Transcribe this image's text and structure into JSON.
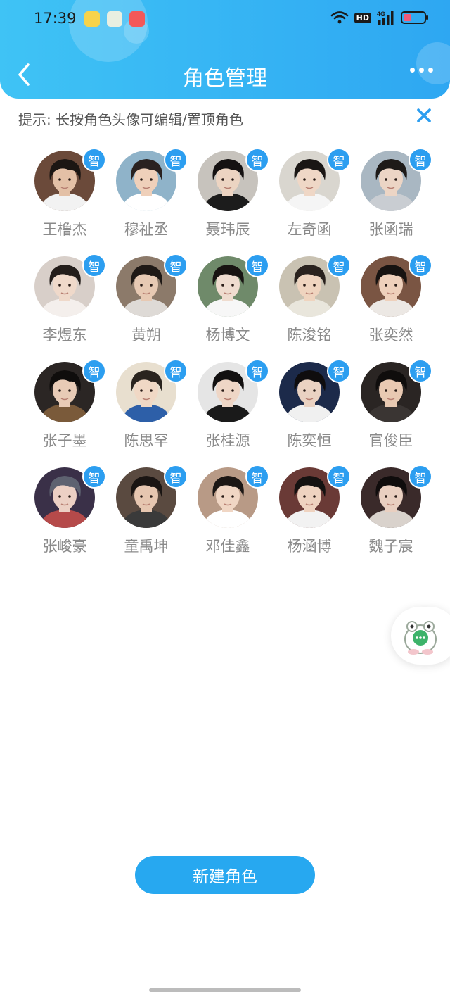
{
  "status_bar": {
    "time": "17:39",
    "hd": "HD",
    "network": "4G"
  },
  "header": {
    "title": "角色管理"
  },
  "hint": {
    "text": "提示: 长按角色头像可编辑/置顶角色"
  },
  "tag_label": "智",
  "characters": [
    {
      "name": "王橹杰",
      "bg": "#6b4a3a",
      "hair": "#1b1613",
      "skin": "#e3c0a6",
      "shirt": "#f2f2f2"
    },
    {
      "name": "穆祉丞",
      "bg": "#8fb3c9",
      "hair": "#2a2220",
      "skin": "#efd0ba",
      "shirt": "#ffffff"
    },
    {
      "name": "聂玮辰",
      "bg": "#c7c3bd",
      "hair": "#151212",
      "skin": "#ecd4c2",
      "shirt": "#1c1c1c"
    },
    {
      "name": "左奇函",
      "bg": "#d9d6cf",
      "hair": "#1a1614",
      "skin": "#efd7c6",
      "shirt": "#f5f5f5"
    },
    {
      "name": "张函瑞",
      "bg": "#a9b7c2",
      "hair": "#1e1a18",
      "skin": "#ecd5c5",
      "shirt": "#c9cdd2"
    },
    {
      "name": "李煜东",
      "bg": "#d8cfc9",
      "hair": "#231d1a",
      "skin": "#efd9ca",
      "shirt": "#f4efec"
    },
    {
      "name": "黄朔",
      "bg": "#8c7a6a",
      "hair": "#1f1916",
      "skin": "#e7c9b3",
      "shirt": "#dedad6"
    },
    {
      "name": "杨博文",
      "bg": "#6f8a6a",
      "hair": "#181412",
      "skin": "#efdccf",
      "shirt": "#f7f7f7"
    },
    {
      "name": "陈浚铭",
      "bg": "#c9c2b2",
      "hair": "#2a221e",
      "skin": "#efd4bf",
      "shirt": "#e9e6dc"
    },
    {
      "name": "张奕然",
      "bg": "#7a5543",
      "hair": "#171311",
      "skin": "#eed0bb",
      "shirt": "#ece8e4"
    },
    {
      "name": "张子墨",
      "bg": "#2b2624",
      "hair": "#0f0d0c",
      "skin": "#e8cbb6",
      "shirt": "#7a5a3a"
    },
    {
      "name": "陈思罕",
      "bg": "#e8dfcf",
      "hair": "#2a241f",
      "skin": "#f0d8c5",
      "shirt": "#2d5fa8"
    },
    {
      "name": "张桂源",
      "bg": "#e5e5e5",
      "hair": "#121010",
      "skin": "#eed6c6",
      "shirt": "#1a1a1a"
    },
    {
      "name": "陈奕恒",
      "bg": "#1c2a4a",
      "hair": "#0f0d0e",
      "skin": "#ead2c2",
      "shirt": "#f0f0f0"
    },
    {
      "name": "官俊臣",
      "bg": "#2a2523",
      "hair": "#0f0d0c",
      "skin": "#e8c9b2",
      "shirt": "#3a3533"
    },
    {
      "name": "张峻豪",
      "bg": "#3a3048",
      "hair": "#5e6270",
      "skin": "#ecd0c4",
      "shirt": "#b54a4a"
    },
    {
      "name": "童禹坤",
      "bg": "#5a4a40",
      "hair": "#1a1513",
      "skin": "#e6c6b0",
      "shirt": "#3a3a3a"
    },
    {
      "name": "邓佳鑫",
      "bg": "#b89a86",
      "hair": "#1c1715",
      "skin": "#f0d6c4",
      "shirt": "#ffffff"
    },
    {
      "name": "杨涵博",
      "bg": "#6a3a36",
      "hair": "#151211",
      "skin": "#efd3c0",
      "shirt": "#f2f2f2"
    },
    {
      "name": "魏子宸",
      "bg": "#3a2a2a",
      "hair": "#0f0c0c",
      "skin": "#e9cfc0",
      "shirt": "#d9d2cc"
    }
  ],
  "new_button": {
    "label": "新建角色"
  },
  "colors": {
    "header_start": "#3fc3f5",
    "header_end": "#2ea7f2",
    "accent": "#27a8f0",
    "tag": "#2c9ef0"
  }
}
